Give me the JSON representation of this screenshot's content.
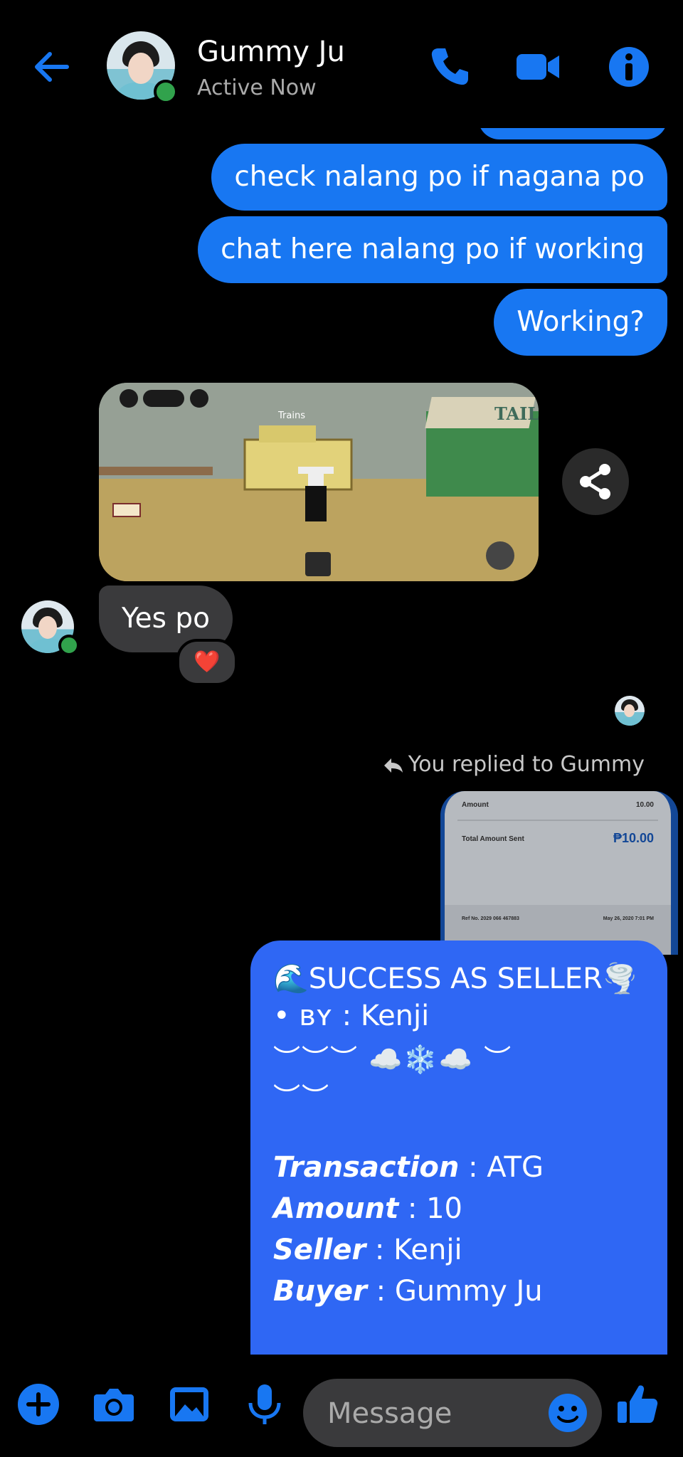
{
  "header": {
    "contact_name": "Gummy Ju",
    "status": "Active Now"
  },
  "messages": {
    "out_1": "check nalang po if nagana po",
    "out_2": "chat here nalang po if working",
    "out_3": "Working?",
    "in_1": "Yes po",
    "reaction": "❤️"
  },
  "game_shot": {
    "sign_text": "Trains",
    "building_sign": "TAIL"
  },
  "reply": {
    "label": "You replied to Gummy"
  },
  "receipt": {
    "row1_label": "Amount",
    "row1_value": "10.00",
    "row2_label": "Total Amount Sent",
    "row2_value": "₱10.00",
    "ref_text": "Ref No. 2029 066 467883",
    "date_text": "May 26, 2020 7:01 PM"
  },
  "seller_post": {
    "title": "🌊SUCCESS AS SELLER🌪️",
    "by_line": "• ʙʏ : Kenji",
    "decor_1": "︶︶︶ ☁️❄️☁️ ︶",
    "decor_2": "︶︶",
    "transaction_label": "Transaction",
    "transaction_value": " : ATG",
    "amount_label": "Amount",
    "amount_value": " : 10",
    "seller_label": "Seller",
    "seller_value": " : Kenji",
    "buyer_label": "Buyer",
    "buyer_value": " : Gummy Ju"
  },
  "composer": {
    "placeholder": "Message"
  },
  "colors": {
    "accent": "#1877f2",
    "bubble_in": "#3a3a3c",
    "seller_card": "#2f67f4",
    "online": "#31a24c"
  },
  "icons": {
    "back": "arrow-left-icon",
    "call": "phone-icon",
    "video": "video-camera-icon",
    "info": "info-icon",
    "share": "share-icon",
    "reply": "reply-arrow-icon",
    "add": "plus-icon",
    "camera": "camera-icon",
    "gallery": "image-icon",
    "mic": "microphone-icon",
    "emoji": "emoji-icon",
    "like": "thumbs-up-icon"
  }
}
